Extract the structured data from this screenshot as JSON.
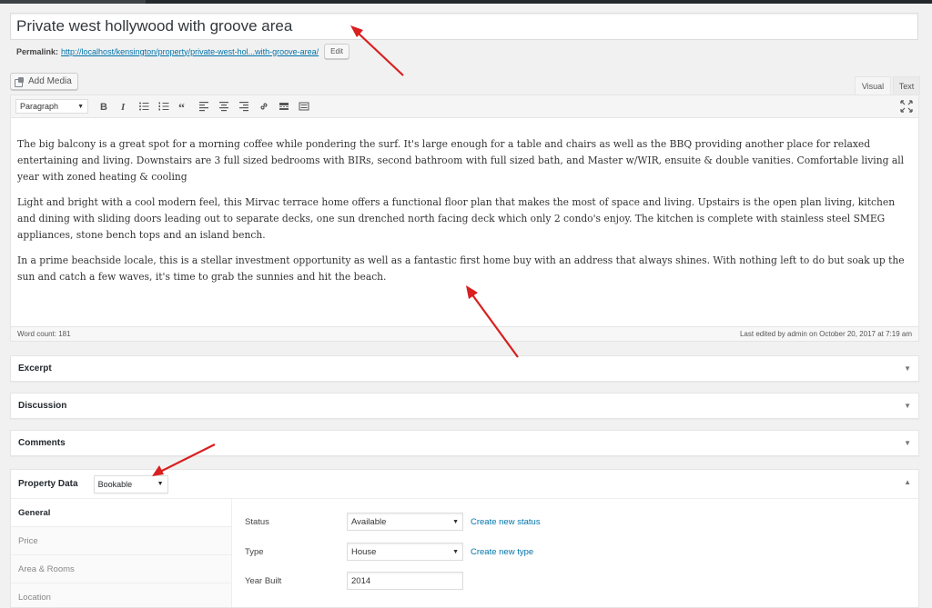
{
  "post": {
    "title": "Private west hollywood with groove area",
    "permalink_label": "Permalink:",
    "permalink_url": "http://localhost/kensington/property/private-west-hol...with-groove-area/",
    "edit_label": "Edit"
  },
  "editor": {
    "add_media_label": "Add Media",
    "tab_visual": "Visual",
    "tab_text": "Text",
    "format_select": "Paragraph",
    "toolbar_icons": [
      "bold-icon",
      "italic-icon",
      "bulleted-list-icon",
      "numbered-list-icon",
      "blockquote-icon",
      "align-left-icon",
      "align-center-icon",
      "align-right-icon",
      "link-icon",
      "read-more-icon",
      "toolbar-toggle-icon",
      "fullscreen-icon"
    ],
    "paragraphs": [
      "The big balcony is a great spot for a morning coffee while pondering the surf. It's large enough for a table and chairs as well as the BBQ providing another place for relaxed entertaining and living. Downstairs are 3 full sized bedrooms with BIRs, second bathroom with full sized bath, and Master w/WIR, ensuite & double vanities. Comfortable living all year with zoned heating & cooling",
      "Light and bright with a cool modern feel, this Mirvac terrace home offers a functional floor plan that makes the most of space and living. Upstairs is the open plan living, kitchen and dining with sliding doors leading out to separate decks, one sun drenched north facing deck which only 2 condo's enjoy. The kitchen is complete with stainless steel SMEG appliances, stone bench tops and an island bench.",
      "In a prime beachside locale, this is a stellar investment opportunity as well as a fantastic first home buy with an address that always shines. With nothing left to do but soak up the sun and catch a few waves, it's time to grab the sunnies and hit the beach."
    ],
    "word_count": "Word count: 181",
    "last_edited": "Last edited by admin on October 20, 2017 at 7:19 am"
  },
  "metaboxes": {
    "excerpt": "Excerpt",
    "discussion": "Discussion",
    "comments": "Comments",
    "toggle_closed": "▼",
    "toggle_open": "▲"
  },
  "property": {
    "title": "Property Data",
    "type_select": "Bookable",
    "tabs": [
      "General",
      "Price",
      "Area & Rooms",
      "Location"
    ],
    "fields": {
      "status_label": "Status",
      "status_value": "Available",
      "status_link": "Create new status",
      "type_label": "Type",
      "type_value": "House",
      "type_link": "Create new type",
      "year_label": "Year Built",
      "year_value": "2014"
    }
  },
  "colors": {
    "annotation_arrow": "#d91f1f",
    "link": "#0073aa"
  }
}
